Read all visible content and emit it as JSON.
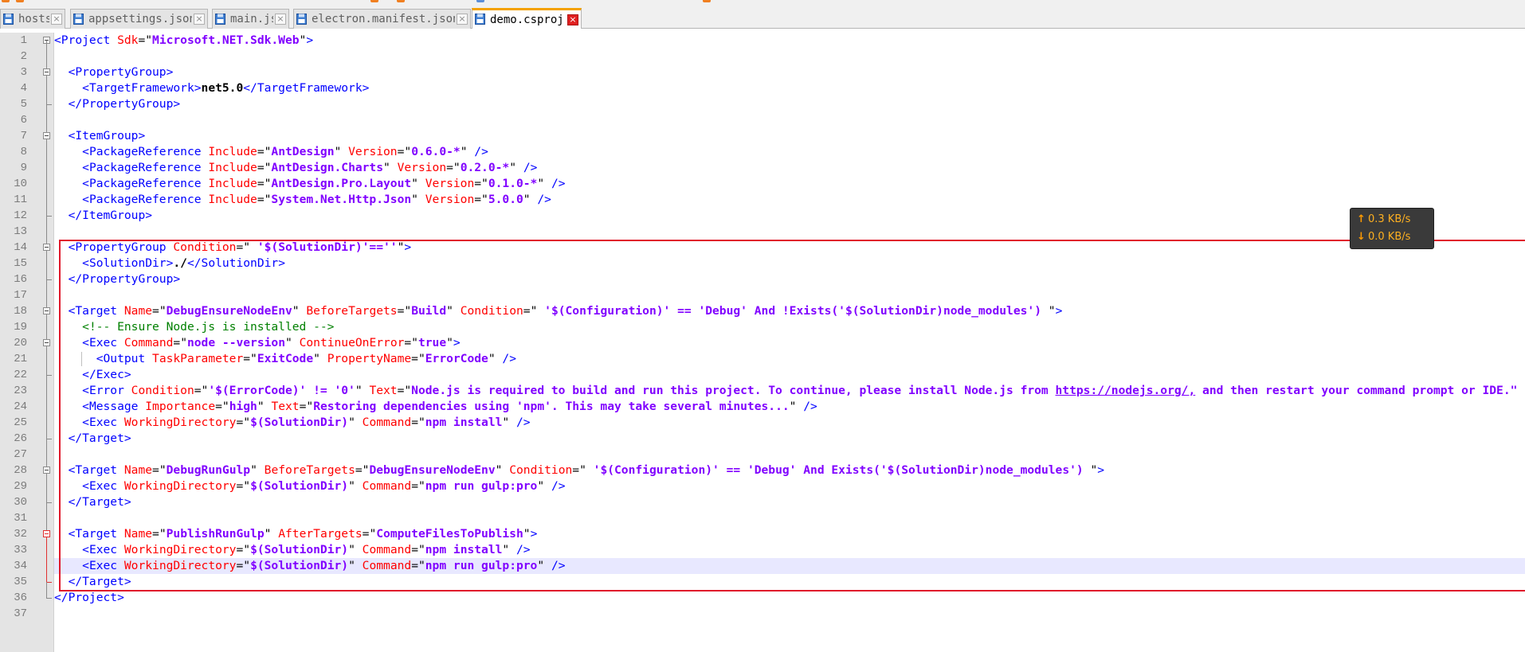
{
  "tabs": [
    {
      "label": "hosts",
      "active": false,
      "icon": "file-icon"
    },
    {
      "label": "appsettings.json",
      "active": false,
      "icon": "file-icon"
    },
    {
      "label": "main.js",
      "active": false,
      "icon": "file-icon"
    },
    {
      "label": "electron.manifest.json",
      "active": false,
      "icon": "file-icon"
    },
    {
      "label": "demo.csproj",
      "active": true,
      "icon": "file-icon"
    }
  ],
  "close_glyph": "×",
  "editor": {
    "current_line": 34,
    "lines": [
      {
        "n": "1"
      },
      {
        "n": "2"
      },
      {
        "n": "3"
      },
      {
        "n": "4"
      },
      {
        "n": "5"
      },
      {
        "n": "6"
      },
      {
        "n": "7"
      },
      {
        "n": "8"
      },
      {
        "n": "9"
      },
      {
        "n": "10"
      },
      {
        "n": "11"
      },
      {
        "n": "12"
      },
      {
        "n": "13"
      },
      {
        "n": "14"
      },
      {
        "n": "15"
      },
      {
        "n": "16"
      },
      {
        "n": "17"
      },
      {
        "n": "18"
      },
      {
        "n": "19"
      },
      {
        "n": "20"
      },
      {
        "n": "21"
      },
      {
        "n": "22"
      },
      {
        "n": "23"
      },
      {
        "n": "24"
      },
      {
        "n": "25"
      },
      {
        "n": "26"
      },
      {
        "n": "27"
      },
      {
        "n": "28"
      },
      {
        "n": "29"
      },
      {
        "n": "30"
      },
      {
        "n": "31"
      },
      {
        "n": "32"
      },
      {
        "n": "33"
      },
      {
        "n": "34"
      },
      {
        "n": "35"
      },
      {
        "n": "36"
      },
      {
        "n": "37"
      }
    ],
    "code": {
      "l1": {
        "tag_open": "<Project",
        "a1": " Sdk",
        "eq": "=\"",
        "v1": "Microsoft.NET.Sdk.Web",
        "close": "\">"
      },
      "l3": {
        "tag": "<PropertyGroup>"
      },
      "l4": {
        "tag_open": "<TargetFramework>",
        "text": "net5.0",
        "tag_close": "</TargetFramework>"
      },
      "l5": {
        "tag": "</PropertyGroup>"
      },
      "l7": {
        "tag": "<ItemGroup>"
      },
      "l8": {
        "tag": "<PackageReference",
        "a1": "Include",
        "v1": "AntDesign",
        "a2": "Version",
        "v2": "0.6.0-*",
        "end": "/>"
      },
      "l9": {
        "tag": "<PackageReference",
        "a1": "Include",
        "v1": "AntDesign.Charts",
        "a2": "Version",
        "v2": "0.2.0-*",
        "end": "/>"
      },
      "l10": {
        "tag": "<PackageReference",
        "a1": "Include",
        "v1": "AntDesign.Pro.Layout",
        "a2": "Version",
        "v2": "0.1.0-*",
        "end": "/>"
      },
      "l11": {
        "tag": "<PackageReference",
        "a1": "Include",
        "v1": "System.Net.Http.Json",
        "a2": "Version",
        "v2": "5.0.0",
        "end": "/>"
      },
      "l12": {
        "tag": "</ItemGroup>"
      },
      "l14": {
        "tag": "<PropertyGroup",
        "a1": "Condition",
        "v1_pre": " ",
        "v1": "'$(SolutionDir)'==''",
        "close": ">"
      },
      "l15": {
        "tag_open": "<SolutionDir>",
        "text": "./",
        "tag_close": "</SolutionDir>"
      },
      "l16": {
        "tag": "</PropertyGroup>"
      },
      "l18": {
        "tag": "<Target",
        "a1": "Name",
        "v1": "DebugEnsureNodeEnv",
        "a2": "BeforeTargets",
        "v2": "Build",
        "a3": "Condition",
        "v3": "'$(Configuration)' == 'Debug' And !Exists('$(SolutionDir)node_modules')",
        "close": ">"
      },
      "l19": {
        "comment": "<!-- Ensure Node.js is installed -->"
      },
      "l20": {
        "tag": "<Exec",
        "a1": "Command",
        "v1": "node --version",
        "a2": "ContinueOnError",
        "v2": "true",
        "close": ">"
      },
      "l21": {
        "tag": "<Output",
        "a1": "TaskParameter",
        "v1": "ExitCode",
        "a2": "PropertyName",
        "v2": "ErrorCode",
        "end": "/>"
      },
      "l22": {
        "tag": "</Exec>"
      },
      "l23": {
        "tag": "<Error",
        "a1": "Condition",
        "v1": "'$(ErrorCode)' != '0'",
        "a2": "Text",
        "v2": "Node.js is required to build and run this project. To continue, please install Node.js from ",
        "link": "https://nodejs.org/,",
        "v2b": " and then restart your command prompt or IDE.\" />"
      },
      "l24": {
        "tag": "<Message",
        "a1": "Importance",
        "v1": "high",
        "a2": "Text",
        "v2": "Restoring dependencies using 'npm'. This may take several minutes...",
        "end": "/>"
      },
      "l25": {
        "tag": "<Exec",
        "a1": "WorkingDirectory",
        "v1": "$(SolutionDir)",
        "a2": "Command",
        "v2": "npm install",
        "end": "/>"
      },
      "l26": {
        "tag": "</Target>"
      },
      "l28": {
        "tag": "<Target",
        "a1": "Name",
        "v1": "DebugRunGulp",
        "a2": "BeforeTargets",
        "v2": "DebugEnsureNodeEnv",
        "a3": "Condition",
        "v3": "'$(Configuration)' == 'Debug' And Exists('$(SolutionDir)node_modules')",
        "close": ">"
      },
      "l29": {
        "tag": "<Exec",
        "a1": "WorkingDirectory",
        "v1": "$(SolutionDir)",
        "a2": "Command",
        "v2": "npm run gulp:pro",
        "end": "/>"
      },
      "l30": {
        "tag": "</Target>"
      },
      "l32": {
        "tag": "<Target",
        "a1": "Name",
        "v1": "PublishRunGulp",
        "a2": "AfterTargets",
        "v2": "ComputeFilesToPublish",
        "close": ">"
      },
      "l33": {
        "tag": "<Exec",
        "a1": "WorkingDirectory",
        "v1": "$(SolutionDir)",
        "a2": "Command",
        "v2": "npm install",
        "end": "/>"
      },
      "l34": {
        "tag": "<Exec",
        "a1": "WorkingDirectory",
        "v1": "$(SolutionDir)",
        "a2": "Command",
        "v2": "npm run gulp:pro",
        "end": "/>"
      },
      "l35": {
        "tag": "</Target>"
      },
      "l36": {
        "tag": "</Project>"
      }
    }
  },
  "netspeed": {
    "upload": "0.3 KB/s",
    "download": "0.0 KB/s",
    "up_arrow": "↑",
    "down_arrow": "↓",
    "color": "#ffb020"
  },
  "colors": {
    "tag": "#0000ff",
    "attribute": "#ff0000",
    "value": "#8000ff",
    "comment": "#008000",
    "highlight_box": "#e0192b",
    "current_line": "#e8e8ff",
    "active_tab_accent": "#f4a100"
  }
}
